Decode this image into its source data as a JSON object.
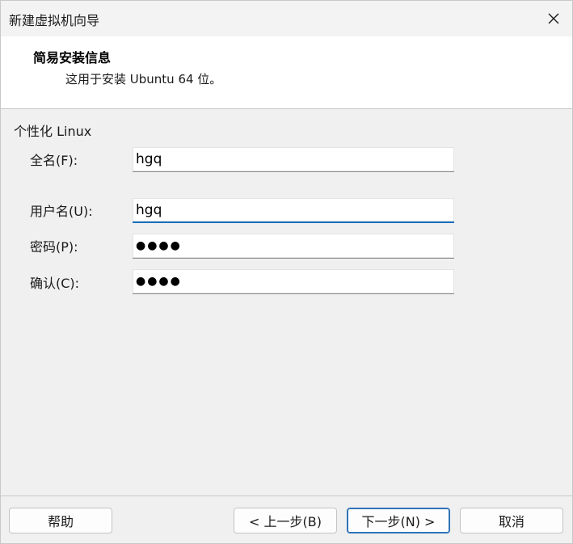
{
  "window": {
    "title": "新建虚拟机向导"
  },
  "header": {
    "title": "简易安装信息",
    "subtitle": "这用于安装 Ubuntu 64 位。"
  },
  "form": {
    "section_label": "个性化 Linux",
    "fullname_label": "全名(F):",
    "fullname_value": "hgq",
    "username_label": "用户名(U):",
    "username_value": "hgq",
    "password_label": "密码(P):",
    "password_value": "●●●●",
    "confirm_label": "确认(C):",
    "confirm_value": "●●●●"
  },
  "footer": {
    "help_label": "帮助",
    "back_label": "< 上一步(B)",
    "next_label": "下一步(N) >",
    "cancel_label": "取消"
  },
  "icons": {
    "close": "close-icon"
  }
}
